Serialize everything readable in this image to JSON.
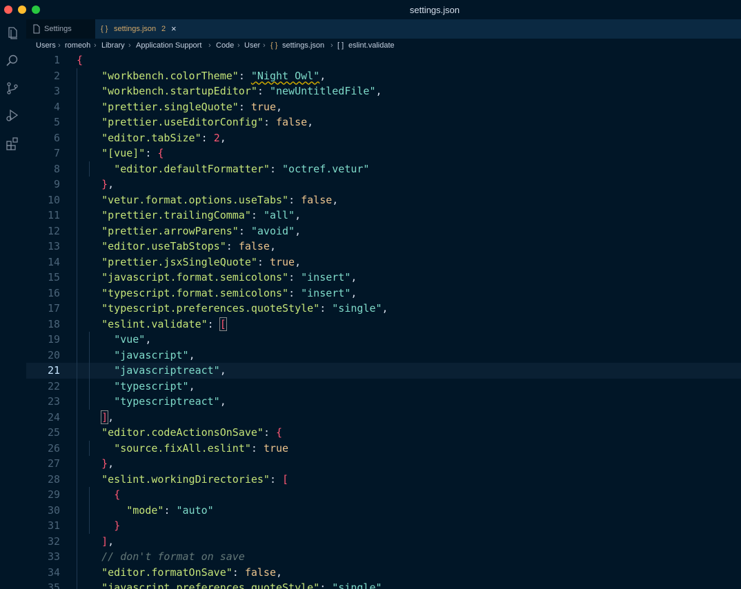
{
  "window": {
    "title": "settings.json"
  },
  "tabs": [
    {
      "label": "Settings"
    },
    {
      "label": "settings.json",
      "badge": "2"
    }
  ],
  "breadcrumb": [
    "Users",
    "romeoh",
    "Library",
    "Application Support",
    "Code",
    "User",
    "settings.json",
    "eslint.validate"
  ],
  "editor": {
    "active_line": 21,
    "lines": [
      {
        "n": "1",
        "t": [
          [
            "b",
            "{"
          ]
        ]
      },
      {
        "n": "2",
        "t": [
          [
            "i",
            "    "
          ],
          [
            "key",
            "\"workbench.colorTheme\""
          ],
          [
            "p",
            ": "
          ],
          [
            "strv wave",
            "\"Night Owl\""
          ],
          [
            "p",
            ","
          ]
        ]
      },
      {
        "n": "3",
        "t": [
          [
            "i",
            "    "
          ],
          [
            "key",
            "\"workbench.startupEditor\""
          ],
          [
            "p",
            ": "
          ],
          [
            "strv",
            "\"newUntitledFile\""
          ],
          [
            "p",
            ","
          ]
        ]
      },
      {
        "n": "4",
        "t": [
          [
            "i",
            "    "
          ],
          [
            "key",
            "\"prettier.singleQuote\""
          ],
          [
            "p",
            ": "
          ],
          [
            "s",
            "true"
          ],
          [
            "p",
            ","
          ]
        ]
      },
      {
        "n": "5",
        "t": [
          [
            "i",
            "    "
          ],
          [
            "key",
            "\"prettier.useEditorConfig\""
          ],
          [
            "p",
            ": "
          ],
          [
            "s",
            "false"
          ],
          [
            "p",
            ","
          ]
        ]
      },
      {
        "n": "6",
        "t": [
          [
            "i",
            "    "
          ],
          [
            "key",
            "\"editor.tabSize\""
          ],
          [
            "p",
            ": "
          ],
          [
            "b",
            "2"
          ],
          [
            "p",
            ","
          ]
        ]
      },
      {
        "n": "7",
        "t": [
          [
            "i",
            "    "
          ],
          [
            "key",
            "\"[vue]\""
          ],
          [
            "p",
            ": "
          ],
          [
            "b",
            "{"
          ]
        ]
      },
      {
        "n": "8",
        "t": [
          [
            "i",
            "      "
          ],
          [
            "key",
            "\"editor.defaultFormatter\""
          ],
          [
            "p",
            ": "
          ],
          [
            "strv",
            "\"octref.vetur\""
          ]
        ]
      },
      {
        "n": "9",
        "t": [
          [
            "i",
            "    "
          ],
          [
            "b",
            "}"
          ],
          [
            "p",
            ","
          ]
        ]
      },
      {
        "n": "10",
        "t": [
          [
            "i",
            "    "
          ],
          [
            "key",
            "\"vetur.format.options.useTabs\""
          ],
          [
            "p",
            ": "
          ],
          [
            "s",
            "false"
          ],
          [
            "p",
            ","
          ]
        ]
      },
      {
        "n": "11",
        "t": [
          [
            "i",
            "    "
          ],
          [
            "key",
            "\"prettier.trailingComma\""
          ],
          [
            "p",
            ": "
          ],
          [
            "strv",
            "\"all\""
          ],
          [
            "p",
            ","
          ]
        ]
      },
      {
        "n": "12",
        "t": [
          [
            "i",
            "    "
          ],
          [
            "key",
            "\"prettier.arrowParens\""
          ],
          [
            "p",
            ": "
          ],
          [
            "strv",
            "\"avoid\""
          ],
          [
            "p",
            ","
          ]
        ]
      },
      {
        "n": "13",
        "t": [
          [
            "i",
            "    "
          ],
          [
            "key",
            "\"editor.useTabStops\""
          ],
          [
            "p",
            ": "
          ],
          [
            "s",
            "false"
          ],
          [
            "p",
            ","
          ]
        ]
      },
      {
        "n": "14",
        "t": [
          [
            "i",
            "    "
          ],
          [
            "key",
            "\"prettier.jsxSingleQuote\""
          ],
          [
            "p",
            ": "
          ],
          [
            "s",
            "true"
          ],
          [
            "p",
            ","
          ]
        ]
      },
      {
        "n": "15",
        "t": [
          [
            "i",
            "    "
          ],
          [
            "key",
            "\"javascript.format.semicolons\""
          ],
          [
            "p",
            ": "
          ],
          [
            "strv",
            "\"insert\""
          ],
          [
            "p",
            ","
          ]
        ]
      },
      {
        "n": "16",
        "t": [
          [
            "i",
            "    "
          ],
          [
            "key",
            "\"typescript.format.semicolons\""
          ],
          [
            "p",
            ": "
          ],
          [
            "strv",
            "\"insert\""
          ],
          [
            "p",
            ","
          ]
        ]
      },
      {
        "n": "17",
        "t": [
          [
            "i",
            "    "
          ],
          [
            "key",
            "\"typescript.preferences.quoteStyle\""
          ],
          [
            "p",
            ": "
          ],
          [
            "strv",
            "\"single\""
          ],
          [
            "p",
            ","
          ]
        ]
      },
      {
        "n": "18",
        "t": [
          [
            "i",
            "    "
          ],
          [
            "key",
            "\"eslint.validate\""
          ],
          [
            "p",
            ": "
          ],
          [
            "b bx",
            "["
          ]
        ]
      },
      {
        "n": "19",
        "t": [
          [
            "i",
            "      "
          ],
          [
            "strv",
            "\"vue\""
          ],
          [
            "p",
            ","
          ]
        ]
      },
      {
        "n": "20",
        "t": [
          [
            "i",
            "      "
          ],
          [
            "strv",
            "\"javascript\""
          ],
          [
            "p",
            ","
          ]
        ]
      },
      {
        "n": "21",
        "t": [
          [
            "i",
            "      "
          ],
          [
            "strv",
            "\"javascriptreact\""
          ],
          [
            "p",
            ","
          ]
        ]
      },
      {
        "n": "22",
        "t": [
          [
            "i",
            "      "
          ],
          [
            "strv",
            "\"typescript\""
          ],
          [
            "p",
            ","
          ]
        ]
      },
      {
        "n": "23",
        "t": [
          [
            "i",
            "      "
          ],
          [
            "strv",
            "\"typescriptreact\""
          ],
          [
            "p",
            ","
          ]
        ]
      },
      {
        "n": "24",
        "t": [
          [
            "i",
            "    "
          ],
          [
            "b bx",
            "]"
          ],
          [
            "p",
            ","
          ]
        ]
      },
      {
        "n": "25",
        "t": [
          [
            "i",
            "    "
          ],
          [
            "key",
            "\"editor.codeActionsOnSave\""
          ],
          [
            "p",
            ": "
          ],
          [
            "b",
            "{"
          ]
        ]
      },
      {
        "n": "26",
        "t": [
          [
            "i",
            "      "
          ],
          [
            "key",
            "\"source.fixAll.eslint\""
          ],
          [
            "p",
            ": "
          ],
          [
            "s",
            "true"
          ]
        ]
      },
      {
        "n": "27",
        "t": [
          [
            "i",
            "    "
          ],
          [
            "b",
            "}"
          ],
          [
            "p",
            ","
          ]
        ]
      },
      {
        "n": "28",
        "t": [
          [
            "i",
            "    "
          ],
          [
            "key",
            "\"eslint.workingDirectories\""
          ],
          [
            "p",
            ": "
          ],
          [
            "b",
            "["
          ]
        ]
      },
      {
        "n": "29",
        "t": [
          [
            "i",
            "      "
          ],
          [
            "b",
            "{"
          ]
        ]
      },
      {
        "n": "30",
        "t": [
          [
            "i",
            "        "
          ],
          [
            "key",
            "\"mode\""
          ],
          [
            "p",
            ": "
          ],
          [
            "strv",
            "\"auto\""
          ]
        ]
      },
      {
        "n": "31",
        "t": [
          [
            "i",
            "      "
          ],
          [
            "b",
            "}"
          ]
        ]
      },
      {
        "n": "32",
        "t": [
          [
            "i",
            "    "
          ],
          [
            "b",
            "]"
          ],
          [
            "p",
            ","
          ]
        ]
      },
      {
        "n": "33",
        "t": [
          [
            "i",
            "    "
          ],
          [
            "com",
            "// don't format on save"
          ]
        ]
      },
      {
        "n": "34",
        "t": [
          [
            "i",
            "    "
          ],
          [
            "key",
            "\"editor.formatOnSave\""
          ],
          [
            "p",
            ": "
          ],
          [
            "s",
            "false"
          ],
          [
            "p",
            ","
          ]
        ]
      },
      {
        "n": "35",
        "t": [
          [
            "i",
            "    "
          ],
          [
            "key",
            "\"javascript.preferences.quoteStyle\""
          ],
          [
            "p",
            ": "
          ],
          [
            "strv",
            "\"single\""
          ],
          [
            "p",
            ","
          ]
        ]
      }
    ]
  },
  "colors": {
    "background": "#011627",
    "tab_active": "#0b2942",
    "accent": "#c5e478"
  },
  "icons": [
    "explorer-icon",
    "search-icon",
    "source-control-icon",
    "run-debug-icon",
    "extensions-icon"
  ]
}
